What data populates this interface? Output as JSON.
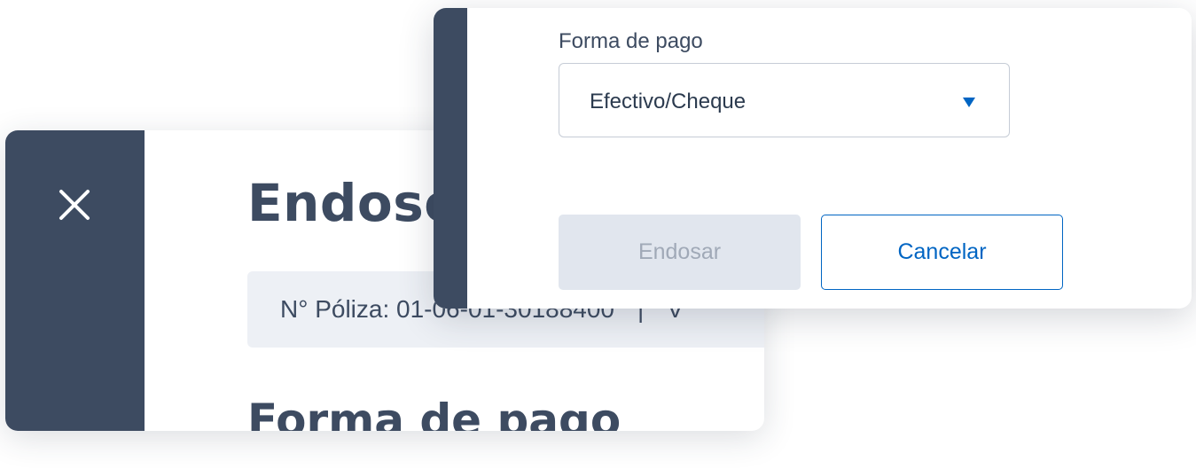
{
  "back_dialog": {
    "title": "Endoso",
    "policy_label": "N° Póliza: 01-06-01-30188400",
    "policy_separator": "|",
    "policy_next": "V",
    "subtitle": "Forma de pago",
    "close_icon": "close-icon"
  },
  "front_dialog": {
    "payment_label": "Forma de pago",
    "payment_value": "Efectivo/Cheque",
    "dropdown_icon": "caret-down-icon",
    "endosar_label": "Endosar",
    "cancel_label": "Cancelar"
  },
  "colors": {
    "rail": "#3d4b61",
    "accent": "#0065c3",
    "disabled_bg": "#e1e6ee",
    "disabled_text": "#a0a9b7",
    "policy_bg": "#edf0f5"
  }
}
